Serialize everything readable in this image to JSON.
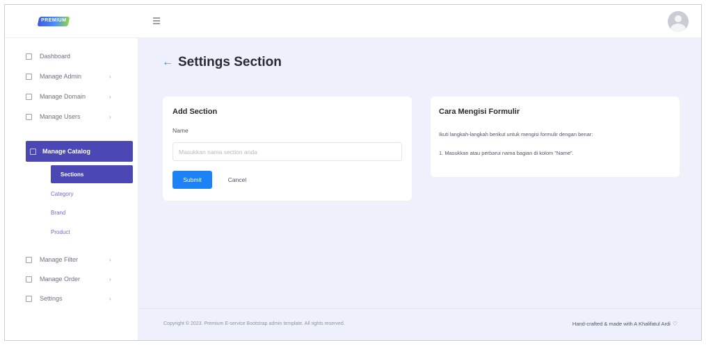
{
  "header": {
    "logo_text": "PREMIUM",
    "menu_icon": "hamburger-icon",
    "avatar_icon": "user-avatar-icon"
  },
  "sidebar": {
    "items": [
      {
        "label": "Dashboard",
        "icon": "dashboard-icon",
        "chevron": ""
      },
      {
        "label": "Manage Admin",
        "icon": "admin-icon",
        "chevron": "›"
      },
      {
        "label": "Manage Domain",
        "icon": "domain-icon",
        "chevron": "›"
      },
      {
        "label": "Manage Users",
        "icon": "users-icon",
        "chevron": "›"
      },
      {
        "label": "Manage Catalog",
        "icon": "catalog-icon",
        "chevron": ""
      },
      {
        "label": "Manage Filter",
        "icon": "filter-icon",
        "chevron": "›"
      },
      {
        "label": "Manage Order",
        "icon": "order-icon",
        "chevron": "›"
      },
      {
        "label": "Settings",
        "icon": "settings-icon",
        "chevron": "›"
      }
    ],
    "catalog_sub": [
      {
        "label": "Sections"
      },
      {
        "label": "Category"
      },
      {
        "label": "Brand"
      },
      {
        "label": "Product"
      }
    ]
  },
  "page": {
    "title": "Settings Section",
    "back_icon": "arrow-left-icon"
  },
  "form": {
    "title": "Add Section",
    "name_label": "Name",
    "name_placeholder": "Masukkan nama section anda",
    "name_value": "",
    "submit_label": "Submit",
    "cancel_label": "Cancel"
  },
  "help": {
    "title": "Cara Mengisi Formulir",
    "intro": "Ikuti langkah-langkah berikut untuk mengisi formulir dengan benar:",
    "steps": [
      "1. Masukkan atau perbarui nama bagian di kolom \"Name\"."
    ]
  },
  "footer": {
    "copyright": "Copyright © 2023. Premium E-service Bootstrap admin template. All rights reserved.",
    "credit": "Hand-crafted & made with A Khalifatul Ardi",
    "heart": "♡"
  },
  "colors": {
    "accent": "#4b47b5",
    "primary_button": "#1d83f5",
    "main_bg": "#eef1fb"
  }
}
